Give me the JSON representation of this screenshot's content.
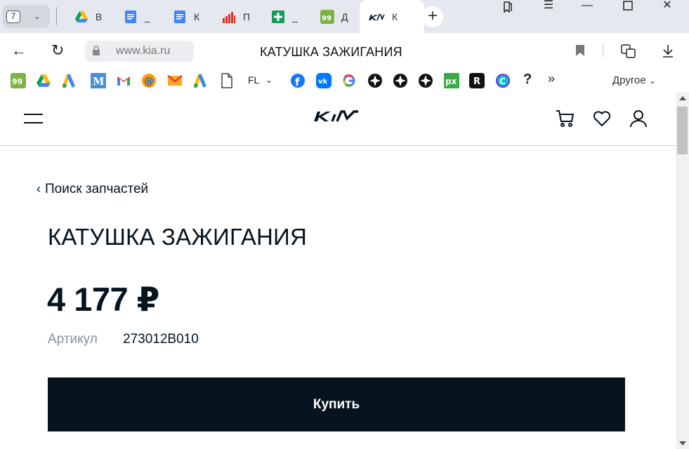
{
  "browser": {
    "tab_count": "7",
    "tabs": [
      {
        "icon": "google-drive-icon",
        "label": "В"
      },
      {
        "icon": "google-docs-icon",
        "label": "_"
      },
      {
        "icon": "google-docs-icon",
        "label": "К"
      },
      {
        "icon": "bar-chart-icon",
        "label": "П"
      },
      {
        "icon": "google-sheets-icon",
        "label": "_"
      },
      {
        "icon": "stats-99-icon",
        "label": "Д"
      },
      {
        "icon": "kia-icon",
        "label": "К",
        "active": true
      }
    ],
    "url": "www.kia.ru",
    "page_title": "КАТУШКА ЗАЖИГАНИЯ",
    "bookmarks": {
      "fl_label": "FL",
      "other_label": "Другое",
      "more": "»"
    }
  },
  "site": {
    "back_link": "Поиск запчастей",
    "product": {
      "title": "КАТУШКА ЗАЖИГАНИЯ",
      "price": "4 177 ₽",
      "sku_label": "Артикул",
      "sku_value": "273012B010",
      "buy_label": "Купить"
    }
  },
  "colors": {
    "brand_dark": "#05141f",
    "muted_text": "#8b9197",
    "tabstrip_bg": "#e5e8ee"
  }
}
